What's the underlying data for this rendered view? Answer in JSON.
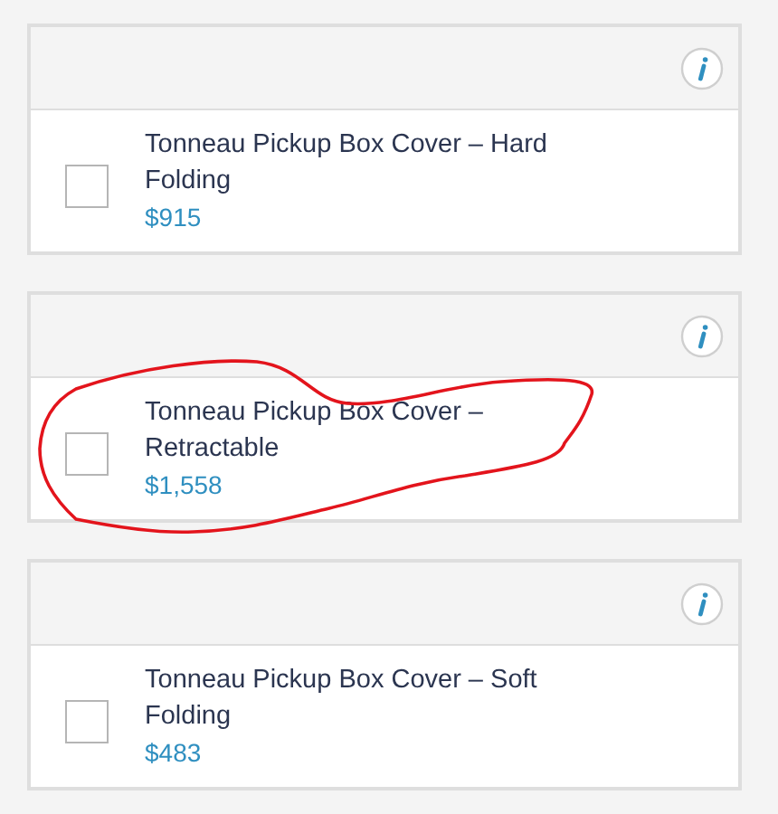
{
  "options": [
    {
      "title": "Tonneau Pickup Box Cover – Hard Folding",
      "price": "$915",
      "checked": false,
      "highlighted": false
    },
    {
      "title": "Tonneau Pickup Box Cover – Retractable",
      "price": "$1,558",
      "checked": false,
      "highlighted": true
    },
    {
      "title": "Tonneau Pickup Box Cover – Soft Folding",
      "price": "$483",
      "checked": false,
      "highlighted": false
    }
  ]
}
